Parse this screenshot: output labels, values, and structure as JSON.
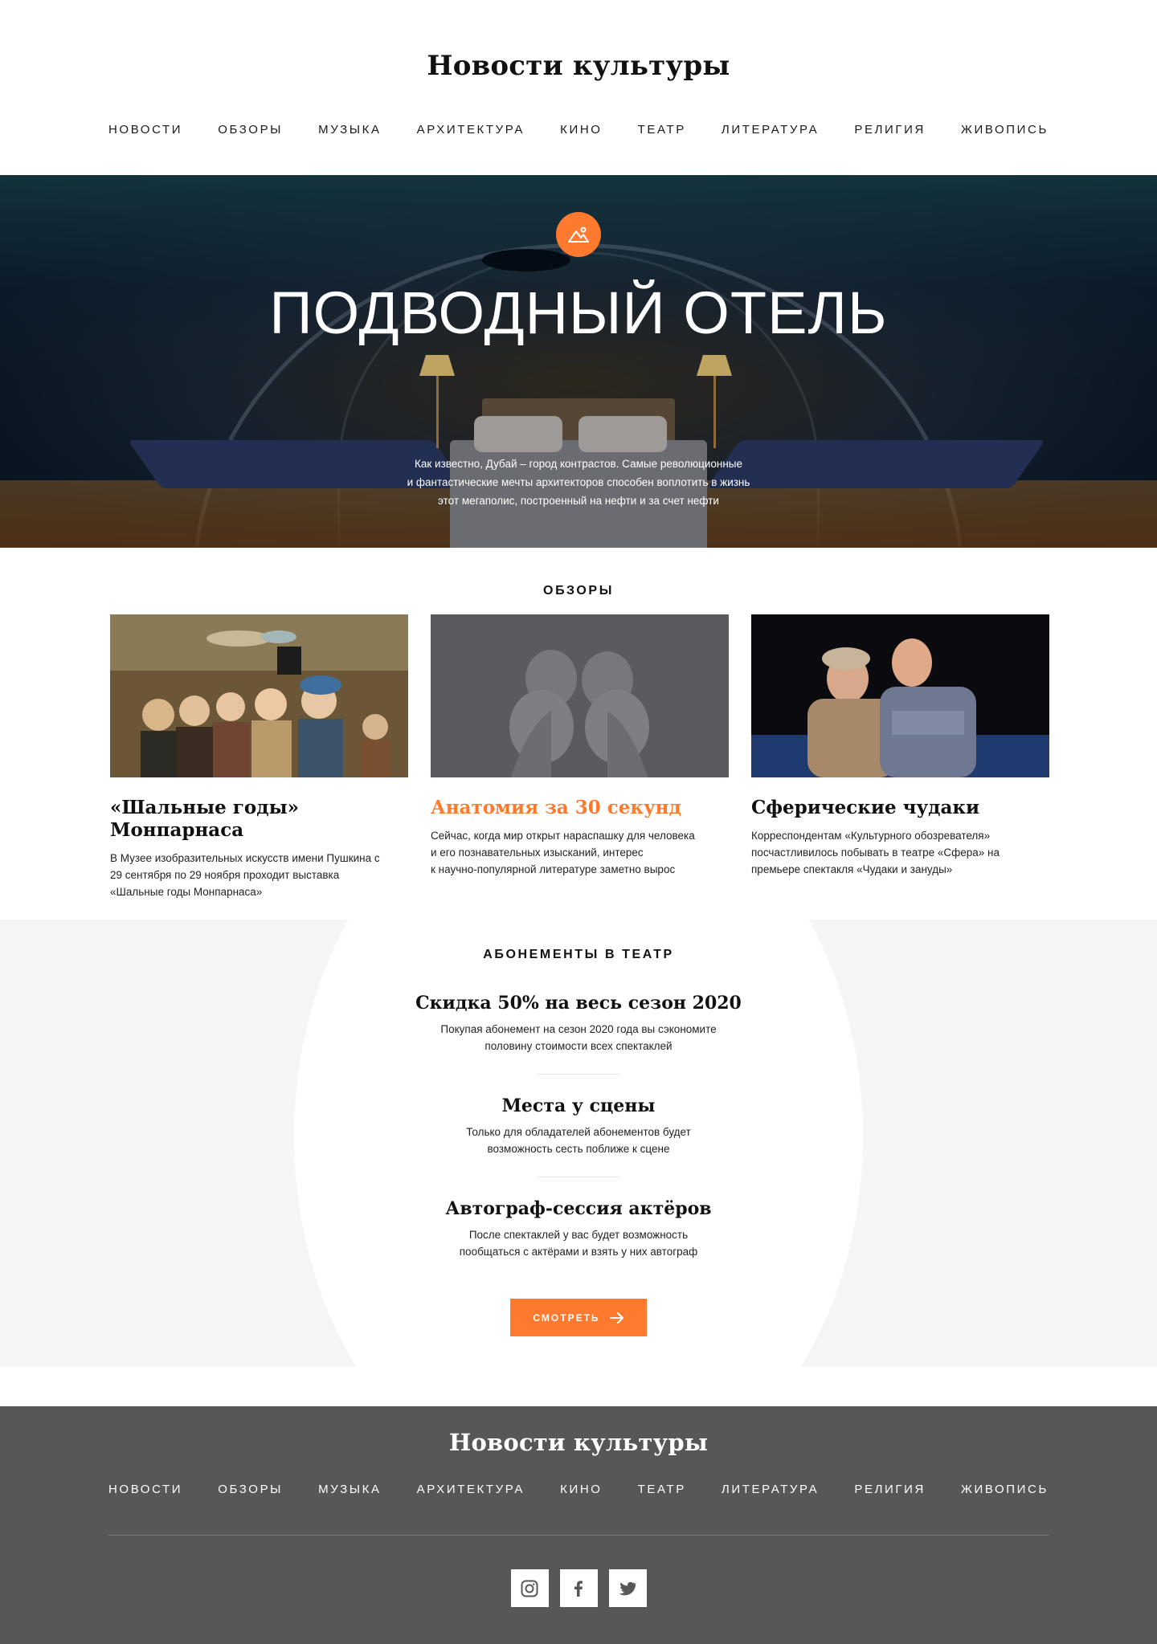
{
  "site": {
    "logo": "Новости культуры"
  },
  "nav": {
    "items": [
      "Новости",
      "Обзоры",
      "Музыка",
      "Архитектура",
      "Кино",
      "Театр",
      "Литература",
      "Религия",
      "Живопись"
    ]
  },
  "hero": {
    "icon": "image-icon",
    "title": "ПОДВОДНЫЙ ОТЕЛЬ",
    "text_lines": [
      "Как известно, Дубай – город контрастов. Самые революционные",
      "и фантастические мечты архитекторов способен воплотить в жизнь",
      "этот мегаполис, построенный на нефти и за счет нефти"
    ]
  },
  "reviews": {
    "label": "Обзоры",
    "cards": [
      {
        "title": "«Шальные годы» Монпарнаса",
        "text_lines": [
          "В Музее изобразительных искусств имени Пушкина с",
          "29 сентября по 29 ноября проходит выставка",
          "«Шальные годы Монпарнаса»"
        ]
      },
      {
        "title": "Анатомия за 30 секунд",
        "text_lines": [
          "Сейчас, когда мир открыт нараспашку для человека",
          "и его познавательных изысканий, интерес",
          "к научно-популярной литературе заметно вырос"
        ]
      },
      {
        "title": "Сферические чудаки",
        "text_lines": [
          "Корреспондентам «Культурного обозревателя»",
          "посчастливилось побывать в театре «Сфера» на",
          "премьере спектакля «Чудаки и зануды»"
        ]
      }
    ]
  },
  "theater": {
    "label": "Абонементы в театр",
    "offers": [
      {
        "title": "Скидка 50% на весь сезон 2020",
        "text_lines": [
          "Покупая абонемент на сезон 2020 года вы сэкономите",
          "половину стоимости всех спектаклей"
        ]
      },
      {
        "title": "Места у сцены",
        "text_lines": [
          "Только для обладателей абонементов будет",
          "возможность сесть поближе к сцене"
        ]
      },
      {
        "title": "Автограф-сессия актёров",
        "text_lines": [
          "После спектаклей у вас будет возможность",
          "пообщаться с актёрами и взять у них автограф"
        ]
      }
    ],
    "cta_label": "Смотреть"
  },
  "footer": {
    "logo": "Новости культуры",
    "socials": [
      "instagram-icon",
      "facebook-icon",
      "twitter-icon"
    ]
  },
  "colors": {
    "accent": "#ff7a2f",
    "footer_bg": "#575757",
    "section_bg": "#f5f5f5"
  }
}
